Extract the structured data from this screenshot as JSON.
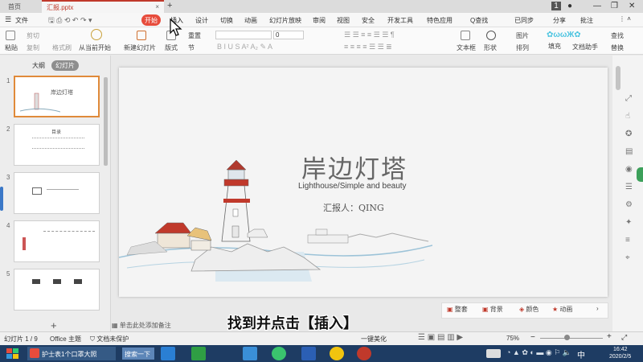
{
  "tabs": {
    "home": "首页",
    "doc": "汇报.pptx"
  },
  "menu": {
    "file": "文件",
    "items": [
      "开始",
      "插入",
      "设计",
      "切换",
      "动画",
      "幻灯片放映",
      "审阅",
      "视图",
      "安全",
      "开发工具",
      "特色应用"
    ],
    "search": "Q查找",
    "sync": "已同步",
    "share": "分享",
    "annotate": "批注"
  },
  "ribbon": {
    "paste": "粘贴",
    "cut": "剪切",
    "copy": "复制",
    "format_painter": "格式刷",
    "from_current": "从当前开始",
    "new_slide": "新建幻灯片",
    "layout": "版式",
    "reset": "重置",
    "section": "节",
    "font_size": "0",
    "textbox": "文本框",
    "shape": "形状",
    "arrange": "排列",
    "picture": "图片",
    "fill": "填充",
    "find": "查找",
    "replace": "替换",
    "text_tool": "文档助手"
  },
  "leftpanel": {
    "outline": "大纲",
    "slides": "幻灯片"
  },
  "thumbs": [
    "1",
    "2",
    "3",
    "4",
    "5"
  ],
  "thumb1_title": "岸边灯塔",
  "thumb2_title": "目录",
  "slide": {
    "title": "岸边灯塔",
    "subtitle": "Lighthouse/Simple and beauty",
    "reporter": "汇报人：QING"
  },
  "slide_toolbar": [
    "整套",
    "背景",
    "颜色",
    "动画"
  ],
  "notes_placeholder": "单击此处添加备注",
  "status": {
    "slide_count": "幻灯片 1 / 9",
    "theme": "Office 主题",
    "protect": "文档未保护",
    "beautify": "一键美化",
    "zoom": "75%"
  },
  "taskbar": {
    "app_label": "护士表1个口罩大照",
    "search_label": "搜索一下",
    "time": "16:42",
    "date": "2020/2/5",
    "ime": "中"
  },
  "caption": "找到并点击【插入】",
  "colors": {
    "accent": "#e74c3c",
    "taskbar": "#1e3c63",
    "selected_thumb": "#e08a3a"
  }
}
